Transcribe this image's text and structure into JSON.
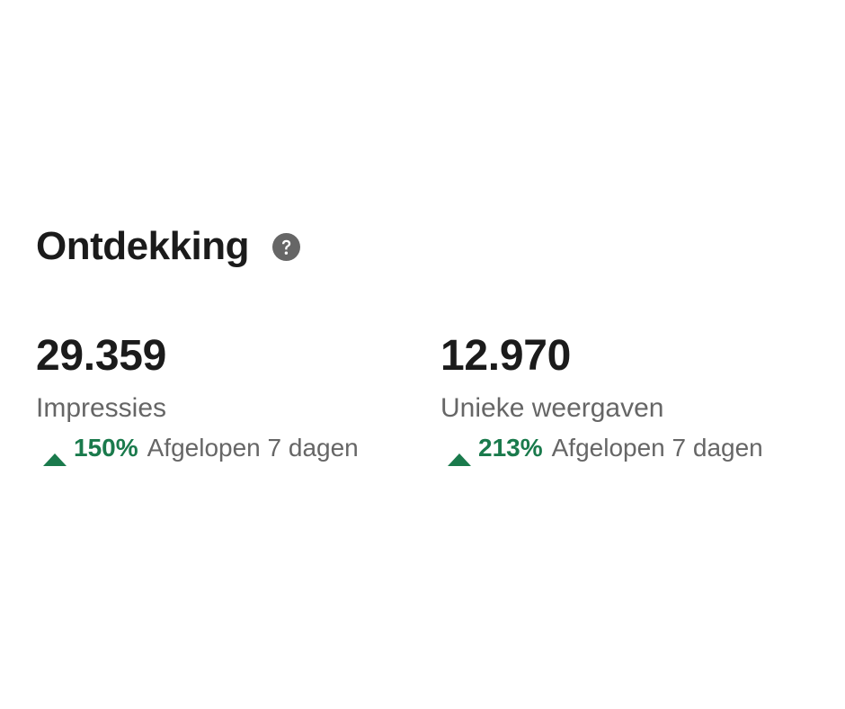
{
  "section": {
    "title": "Ontdekking",
    "help_icon": "question-circle-icon"
  },
  "metrics": [
    {
      "value": "29.359",
      "label": "Impressies",
      "trend": {
        "direction": "up",
        "value": "150%",
        "period": "Afgelopen 7 dagen"
      }
    },
    {
      "value": "12.970",
      "label": "Unieke weergaven",
      "trend": {
        "direction": "up",
        "value": "213%",
        "period": "Afgelopen 7 dagen"
      }
    }
  ],
  "colors": {
    "positive": "#1a7a4c",
    "muted_text": "#666666",
    "primary_text": "#1b1b1b",
    "icon": "#666666"
  }
}
